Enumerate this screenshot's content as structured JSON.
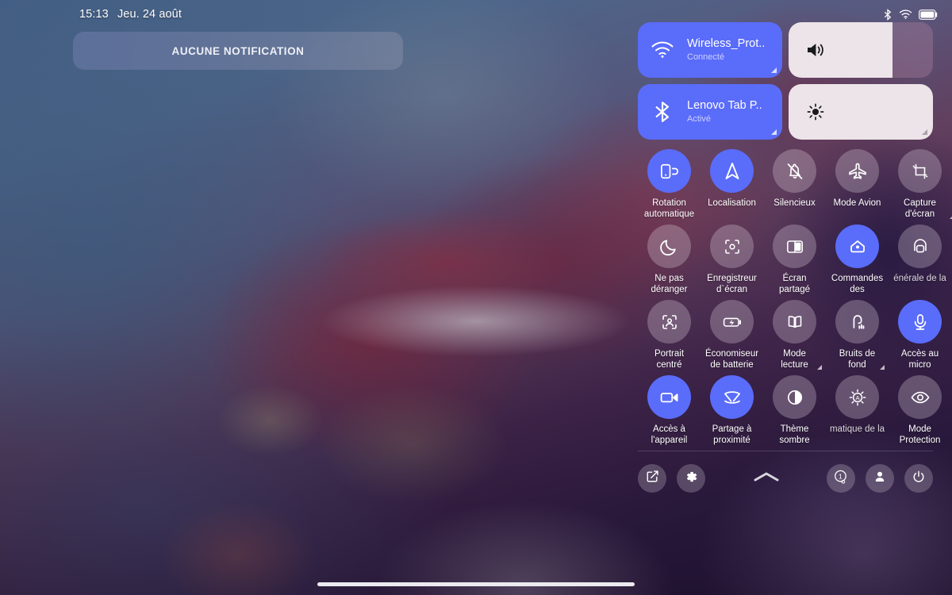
{
  "statusbar": {
    "time": "15:13",
    "date": "Jeu. 24 août",
    "icons": [
      "bluetooth-icon",
      "wifi-icon",
      "battery-icon"
    ]
  },
  "notification": {
    "text": "AUCUNE NOTIFICATION"
  },
  "connectivity": [
    {
      "name": "wifi-tile",
      "icon": "wifi-icon",
      "title": "Wireless_Prot..",
      "subtitle": "Connecté",
      "active": true,
      "expandable": true
    },
    {
      "name": "bluetooth-tile",
      "icon": "bluetooth-icon",
      "title": "Lenovo Tab P..",
      "subtitle": "Activé",
      "active": true,
      "expandable": true
    }
  ],
  "sliders": [
    {
      "name": "volume-slider",
      "icon": "volume-icon",
      "value": 72,
      "expandable": false
    },
    {
      "name": "brightness-slider",
      "icon": "brightness-icon",
      "value": 100,
      "expandable": true
    }
  ],
  "tiles": [
    [
      {
        "label": "Rotation\nautomatique",
        "icon": "auto-rotate-icon",
        "active": true,
        "expandable": false,
        "truncated": false
      },
      {
        "label": "Localisation",
        "icon": "location-icon",
        "active": true,
        "expandable": false,
        "truncated": false
      },
      {
        "label": "Silencieux",
        "icon": "bell-off-icon",
        "active": false,
        "expandable": false,
        "truncated": false
      },
      {
        "label": "Mode Avion",
        "icon": "airplane-icon",
        "active": false,
        "expandable": false,
        "truncated": false
      },
      {
        "label": "Capture\nd'écran",
        "icon": "screenshot-crop-icon",
        "active": false,
        "expandable": true,
        "truncated": false
      }
    ],
    [
      {
        "label": "Ne pas\ndéranger",
        "icon": "moon-icon",
        "active": false,
        "expandable": false,
        "truncated": false
      },
      {
        "label": "Enregistreur\nd`écran",
        "icon": "screen-record-icon",
        "active": false,
        "expandable": false,
        "truncated": false
      },
      {
        "label": "Écran\npartagé",
        "icon": "split-screen-icon",
        "active": false,
        "expandable": false,
        "truncated": false
      },
      {
        "label": "Commandes\ndes",
        "icon": "home-controls-icon",
        "active": true,
        "expandable": false,
        "truncated": false
      },
      {
        "label": "énérale de la",
        "icon": "cast-icon",
        "active": false,
        "expandable": false,
        "truncated": true
      }
    ],
    [
      {
        "label": "Portrait\ncentré",
        "icon": "center-portrait-icon",
        "active": false,
        "expandable": false,
        "truncated": false
      },
      {
        "label": "Économiseur\nde batterie",
        "icon": "battery-saver-icon",
        "active": false,
        "expandable": false,
        "truncated": false
      },
      {
        "label": "Mode\nlecture",
        "icon": "book-icon",
        "active": false,
        "expandable": true,
        "truncated": false
      },
      {
        "label": "Bruits de\nfond",
        "icon": "ambient-sound-icon",
        "active": false,
        "expandable": true,
        "truncated": false
      },
      {
        "label": "Accès au\nmicro",
        "icon": "microphone-icon",
        "active": true,
        "expandable": false,
        "truncated": false
      }
    ],
    [
      {
        "label": "Accès à\nl'appareil",
        "icon": "camera-access-icon",
        "active": true,
        "expandable": false,
        "truncated": false
      },
      {
        "label": "Partage à\nproximité",
        "icon": "nearby-share-icon",
        "active": true,
        "expandable": false,
        "truncated": false
      },
      {
        "label": "Thème\nsombre",
        "icon": "dark-theme-icon",
        "active": false,
        "expandable": false,
        "truncated": false
      },
      {
        "label": "matique de la",
        "icon": "auto-brightness-icon",
        "active": false,
        "expandable": false,
        "truncated": true
      },
      {
        "label": "Mode\nProtection",
        "icon": "eye-protection-icon",
        "active": false,
        "expandable": false,
        "truncated": false
      }
    ]
  ],
  "bottombar": {
    "left": [
      {
        "name": "edit-tiles-button",
        "icon": "edit-icon"
      },
      {
        "name": "settings-button",
        "icon": "gear-icon"
      }
    ],
    "middle": {
      "name": "collapse-panel-button",
      "icon": "chevron-up-icon"
    },
    "right": [
      {
        "name": "running-apps-button",
        "icon": "running-apps-badge-icon"
      },
      {
        "name": "user-button",
        "icon": "person-icon"
      },
      {
        "name": "power-button",
        "icon": "power-icon"
      }
    ]
  },
  "colors": {
    "active_tile": "#5a6cfa",
    "slider_fill": "#ece4e8",
    "text": "#ffffff"
  }
}
